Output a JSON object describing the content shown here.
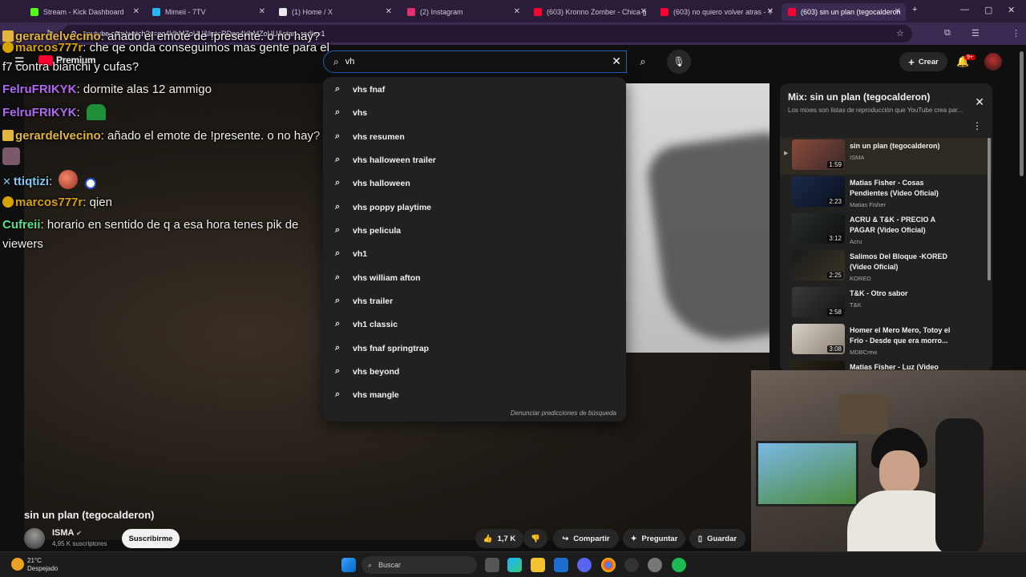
{
  "browser": {
    "tabs": [
      {
        "title": "Stream - Kick Dashboard",
        "color": "#53fc18"
      },
      {
        "title": "Mimeii - 7TV",
        "color": "#29b6f6"
      },
      {
        "title": "(1) Home / X",
        "color": "#e7e9ea"
      },
      {
        "title": "(2) Instagram",
        "color": "#e1306c"
      },
      {
        "title": "(603) Kronno Zomber - Chica g",
        "color": "#ff0033"
      },
      {
        "title": "(603) no quiero volver atras - Y",
        "color": "#ff0033"
      },
      {
        "title": "(603) sin un plan (tegocalderon",
        "color": "#ff0033"
      }
    ],
    "url": "youtube.com/watch?v=ge4klhMZoUU&list=RDge4klhMZoUU&start_radio=1"
  },
  "chat": [
    {
      "name": "gerardelvecino",
      "color": "#e3b53a",
      "text": ": añado el emote de !presente. o no hay?",
      "badge": "crown"
    },
    {
      "name": "marcos777r",
      "color": "#d8a300",
      "text": ": che qe onda conseguimos mas gente para el",
      "cont": "f7 contra bianchi y cufas?",
      "badge": "warn"
    },
    {
      "name": "FelruFRIKYK",
      "color": "#b06af5",
      "text": ": dormite alas 12 ammigo"
    },
    {
      "name": "FelruFRIKYK",
      "color": "#b06af5",
      "text": ":"
    },
    {
      "name": "gerardelvecino",
      "color": "#e3b53a",
      "text": ": añado el emote de !presente. o no hay?",
      "badge": "crown"
    },
    {
      "name": "ttiqtizi",
      "color": "#7ec8f5",
      "text": ":",
      "badge": "sword"
    },
    {
      "name": "marcos777r",
      "color": "#d8a300",
      "text": ": qien",
      "badge": "warn"
    },
    {
      "name": "Cufreii",
      "color": "#53e08a",
      "text": ": horario en sentido de q a esa hora tenes pik de",
      "cont": "viewers"
    }
  ],
  "youtube": {
    "logo_text": "Premium",
    "search": {
      "value": "vh"
    },
    "suggestions": [
      "vhs fnaf",
      "vhs",
      "vhs resumen",
      "vhs halloween trailer",
      "vhs halloween",
      "vhs poppy playtime",
      "vhs pelicula",
      "vh1",
      "vhs william afton",
      "vhs trailer",
      "vh1 classic",
      "vhs fnaf springtrap",
      "vhs beyond",
      "vhs mangle"
    ],
    "report_text": "Denunciar predicciones de búsqueda",
    "create_label": "Crear",
    "notif_badge": "9+",
    "playlist": {
      "title": "Mix: sin un plan (tegocalderon)",
      "subtitle": "Los mixes son listas de reproducción que YouTube crea par...",
      "items": [
        {
          "title": "sin un plan (tegocalderon)",
          "channel": "ISMA",
          "duration": "1:59",
          "current": true
        },
        {
          "title": "Matias Fisher - Cosas Pendientes (Video Oficial)",
          "channel": "Matias Fisher",
          "duration": "2:23"
        },
        {
          "title": "ACRU & T&K - PRECIO A PAGAR (Video Oficial)",
          "channel": "Acru",
          "duration": "3:12"
        },
        {
          "title": "Salimos Del Bloque -KORED (Video Oficial)",
          "channel": "KORED",
          "duration": "2:25"
        },
        {
          "title": "T&K - Otro sabor",
          "channel": "T&K",
          "duration": "2:58"
        },
        {
          "title": "Homer el Mero Mero, Totoy el Frio - Desde que era morro...",
          "channel": "MDBCrew",
          "duration": "3:08"
        },
        {
          "title": "Matias Fisher - Luz (Video",
          "channel": "",
          "duration": ""
        }
      ]
    },
    "video": {
      "title": "sin un plan (tegocalderon)",
      "channel": "ISMA",
      "subscribers": "4,95 K suscriptores",
      "subscribe_label": "Suscribirme",
      "likes": "1,7 K",
      "share_label": "Compartir",
      "ask_label": "Preguntar",
      "save_label": "Guardar"
    }
  },
  "taskbar": {
    "temperature": "21°C",
    "weather": "Despejado",
    "search_placeholder": "Buscar"
  }
}
